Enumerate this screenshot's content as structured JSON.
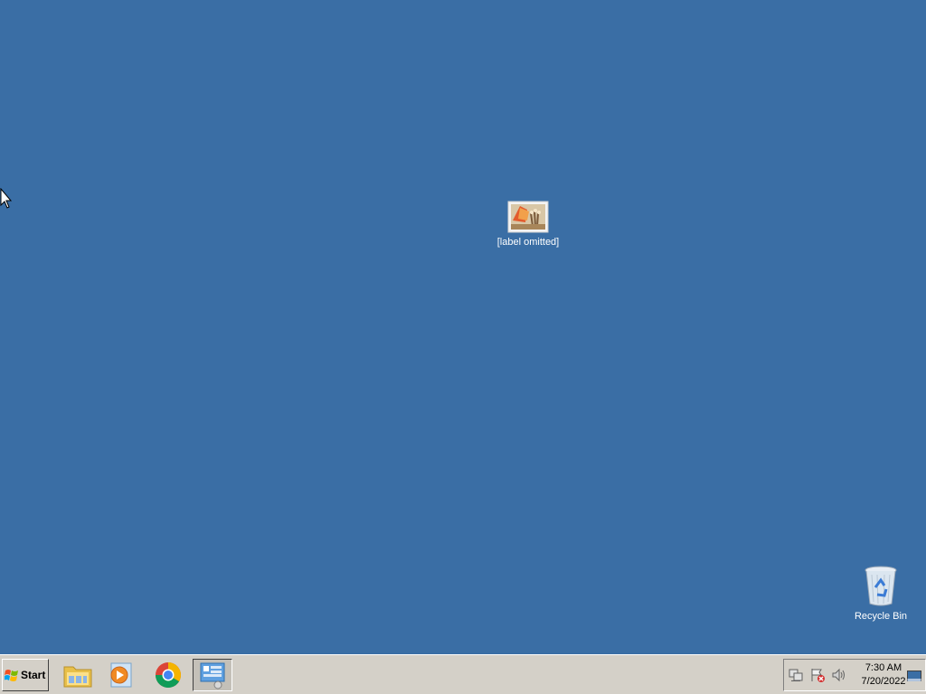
{
  "desktop": {
    "file_icon": {
      "label_line1": "[label omitted]",
      "label_line2": "",
      "icon": "image-file-icon"
    },
    "recycle_bin": {
      "label": "Recycle Bin",
      "icon": "recycle-bin-icon"
    }
  },
  "taskbar": {
    "start_label": "Start",
    "quick_launch": [
      {
        "name": "file-explorer-icon"
      },
      {
        "name": "media-player-icon"
      },
      {
        "name": "chrome-icon"
      },
      {
        "name": "control-panel-icon",
        "active": true
      }
    ],
    "tray": {
      "icons": [
        "network-icon",
        "action-center-icon",
        "volume-icon"
      ],
      "time": "7:30 AM",
      "date": "7/20/2022"
    }
  },
  "colors": {
    "desktop_bg": "#3a6ea5",
    "taskbar_bg": "#d4d0c8"
  }
}
